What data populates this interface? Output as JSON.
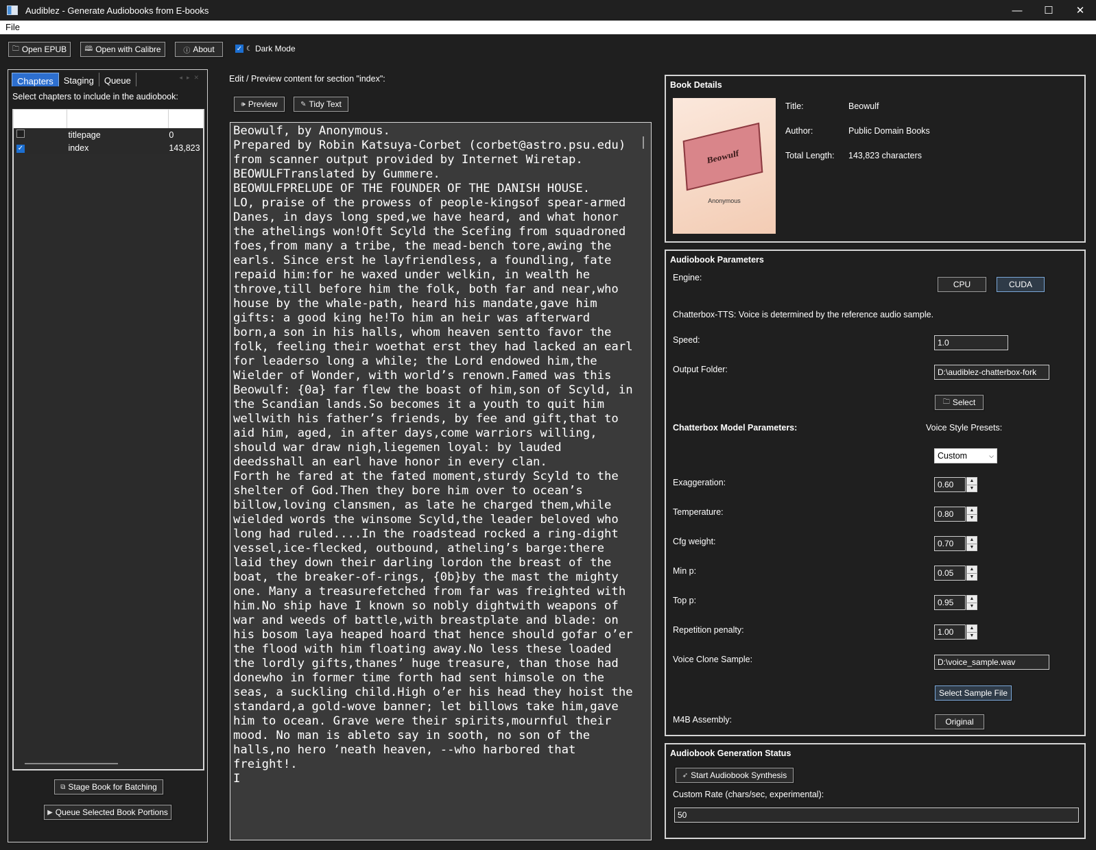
{
  "window": {
    "title": "Audiblez - Generate Audiobooks from E-books",
    "controls": [
      "—",
      "☐",
      "✕"
    ]
  },
  "menu": {
    "file": "File"
  },
  "toolbar": {
    "open_epub": "Open EPUB",
    "open_calibre": "Open with Calibre",
    "about": "About",
    "dark_mode": "Dark Mode",
    "dark_mode_checked": true
  },
  "left": {
    "tabs": [
      "Chapters",
      "Staging",
      "Queue"
    ],
    "instruction": "Select chapters to include in the audiobook:",
    "chapters": [
      {
        "checked": false,
        "name": "titlepage",
        "length": "0"
      },
      {
        "checked": true,
        "name": "index",
        "length": "143,823"
      }
    ],
    "stage_button": "Stage Book for Batching",
    "queue_button": "Queue Selected Book Portions"
  },
  "middle": {
    "section_label": "Edit / Preview content for section \"index\":",
    "preview_button": "Preview",
    "tidy_button": "Tidy Text",
    "content": "Beowulf, by Anonymous.\nPrepared by Robin Katsuya-Corbet (corbet@astro.psu.edu) from scanner output provided by Internet Wiretap.\nBEOWULFTranslated by Gummere.\nBEOWULFPRELUDE OF THE FOUNDER OF THE DANISH HOUSE.\nLO, praise of the prowess of people-kingsof spear-armed Danes, in days long sped,we have heard, and what honor the athelings won!Oft Scyld the Scefing from squadroned foes,from many a tribe, the mead-bench tore,awing the earls. Since erst he layfriendless, a foundling, fate repaid him:for he waxed under welkin, in wealth he throve,till before him the folk, both far and near,who house by the whale-path, heard his mandate,gave him gifts: a good king he!To him an heir was afterward born,a son in his halls, whom heaven sentto favor the folk, feeling their woethat erst they had lacked an earl for leaderso long a while; the Lord endowed him,the Wielder of Wonder, with world’s renown.Famed was this Beowulf: {0a} far flew the boast of him,son of Scyld, in the Scandian lands.So becomes it a youth to quit him wellwith his father’s friends, by fee and gift,that to aid him, aged, in after days,come warriors willing, should war draw nigh,liegemen loyal: by lauded deedsshall an earl have honor in every clan.\nForth he fared at the fated moment,sturdy Scyld to the shelter of God.Then they bore him over to ocean’s billow,loving clansmen, as late he charged them,while wielded words the winsome Scyld,the leader beloved who long had ruled....In the roadstead rocked a ring-dight vessel,ice-flecked, outbound, atheling’s barge:there laid they down their darling lordon the breast of the boat, the breaker-of-rings, {0b}by the mast the mighty one. Many a treasurefetched from far was freighted with him.No ship have I known so nobly dightwith weapons of war and weeds of battle,with breastplate and blade: on his bosom laya heaped hoard that hence should gofar o’er the flood with him floating away.No less these loaded the lordly gifts,thanes’ huge treasure, than those had donewho in former time forth had sent himsole on the seas, a suckling child.High o’er his head they hoist the standard,a gold-wove banner; let billows take him,gave him to ocean. Grave were their spirits,mournful their mood. No man is ableto say in sooth, no son of the halls,no hero ’neath heaven, --who harbored that freight!.\nI"
  },
  "book": {
    "group_title": "Book Details",
    "cover_title": "Beowulf",
    "cover_author": "Anonymous",
    "title_label": "Title:",
    "title": "Beowulf",
    "author_label": "Author:",
    "author": "Public Domain Books",
    "length_label": "Total Length:",
    "length": "143,823 characters"
  },
  "params": {
    "group_title": "Audiobook Parameters",
    "engine_label": "Engine:",
    "engines": [
      "CPU",
      "CUDA"
    ],
    "engine_selected": "CUDA",
    "engine_note": "Chatterbox-TTS: Voice is determined by the reference audio sample.",
    "speed_label": "Speed:",
    "speed": "1.0",
    "output_label": "Output Folder:",
    "output": "D:\\audiblez-chatterbox-fork",
    "select_button": "Select",
    "model_params_label": "Chatterbox Model Parameters:",
    "presets_label": "Voice Style Presets:",
    "preset": "Custom",
    "exaggeration_label": "Exaggeration:",
    "exaggeration": "0.60",
    "temperature_label": "Temperature:",
    "temperature": "0.80",
    "cfg_label": "Cfg weight:",
    "cfg": "0.70",
    "minp_label": "Min p:",
    "minp": "0.05",
    "topp_label": "Top p:",
    "topp": "0.95",
    "rep_label": "Repetition penalty:",
    "rep": "1.00",
    "clone_label": "Voice Clone Sample:",
    "clone": "D:\\voice_sample.wav",
    "sample_button": "Select Sample File",
    "m4b_label": "M4B Assembly:",
    "m4b_button": "Original"
  },
  "status": {
    "group_title": "Audiobook Generation Status",
    "start_button": "Start Audiobook Synthesis",
    "rate_label": "Custom Rate (chars/sec, experimental):",
    "rate": "50"
  },
  "colors": {
    "accent": "#2d6fcf",
    "background": "#1f1f1f",
    "editor": "#3a3a3a"
  }
}
